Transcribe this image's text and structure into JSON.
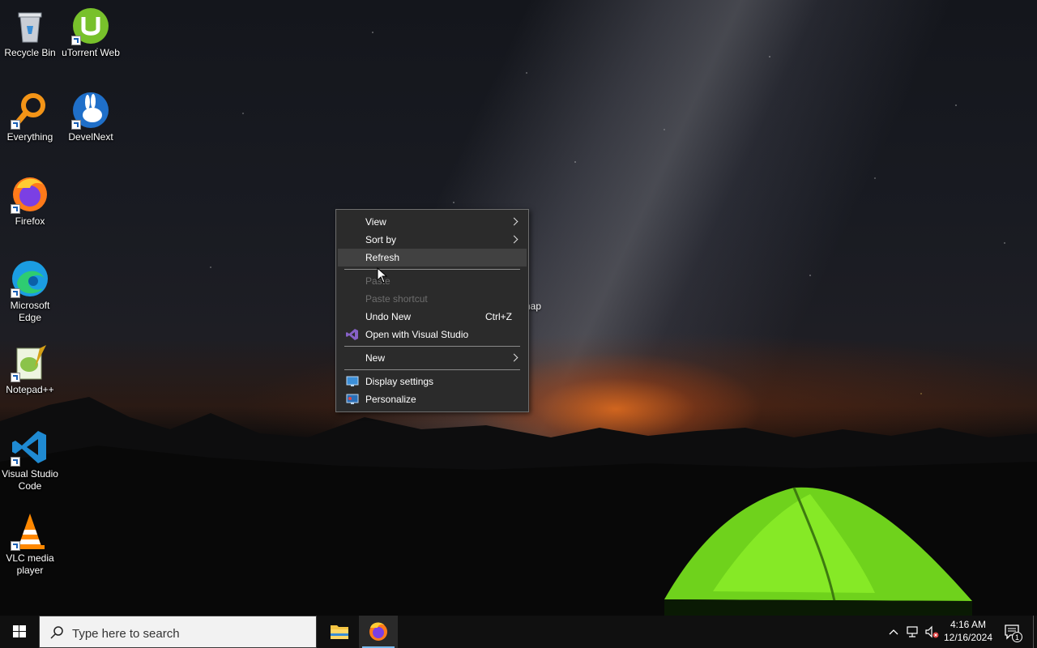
{
  "desktop": {
    "icons": [
      {
        "label": "Recycle Bin",
        "icon": "recycle-bin-icon"
      },
      {
        "label": "uTorrent Web",
        "icon": "utorrent-icon"
      },
      {
        "label": "Everything",
        "icon": "everything-search-icon"
      },
      {
        "label": "DevelNext",
        "icon": "develnext-icon"
      },
      {
        "label": "Firefox",
        "icon": "firefox-icon"
      },
      {
        "label": "Microsoft Edge",
        "icon": "edge-icon"
      },
      {
        "label": "Notepad++",
        "icon": "notepadpp-icon"
      },
      {
        "label": "Visual Studio Code",
        "icon": "vscode-icon"
      },
      {
        "label": "VLC media player",
        "icon": "vlc-icon"
      }
    ],
    "partial_label": "nap"
  },
  "context_menu": {
    "items": [
      {
        "label": "View",
        "submenu": true
      },
      {
        "label": "Sort by",
        "submenu": true
      },
      {
        "label": "Refresh",
        "highlighted": true
      },
      {
        "label": "Paste",
        "disabled": true
      },
      {
        "label": "Paste shortcut",
        "disabled": true
      },
      {
        "label": "Undo New",
        "shortcut": "Ctrl+Z"
      },
      {
        "label": "Open with Visual Studio",
        "icon": "visual-studio-icon"
      },
      {
        "label": "New",
        "submenu": true
      },
      {
        "label": "Display settings",
        "icon": "display-settings-icon"
      },
      {
        "label": "Personalize",
        "icon": "personalize-icon"
      }
    ]
  },
  "taskbar": {
    "search_placeholder": "Type here to search",
    "pinned_apps": [
      {
        "name": "File Explorer",
        "icon": "file-explorer-icon"
      },
      {
        "name": "Firefox",
        "icon": "firefox-icon",
        "active": true
      }
    ],
    "tray": {
      "time": "4:16 AM",
      "date": "12/16/2024",
      "notification_count": "1"
    }
  },
  "colors": {
    "menu_bg": "#2b2b2b",
    "menu_highlight": "#414141",
    "menu_disabled_text": "#6d6d6d",
    "taskbar_bg": "#101010",
    "active_indicator": "#76b9ed"
  }
}
